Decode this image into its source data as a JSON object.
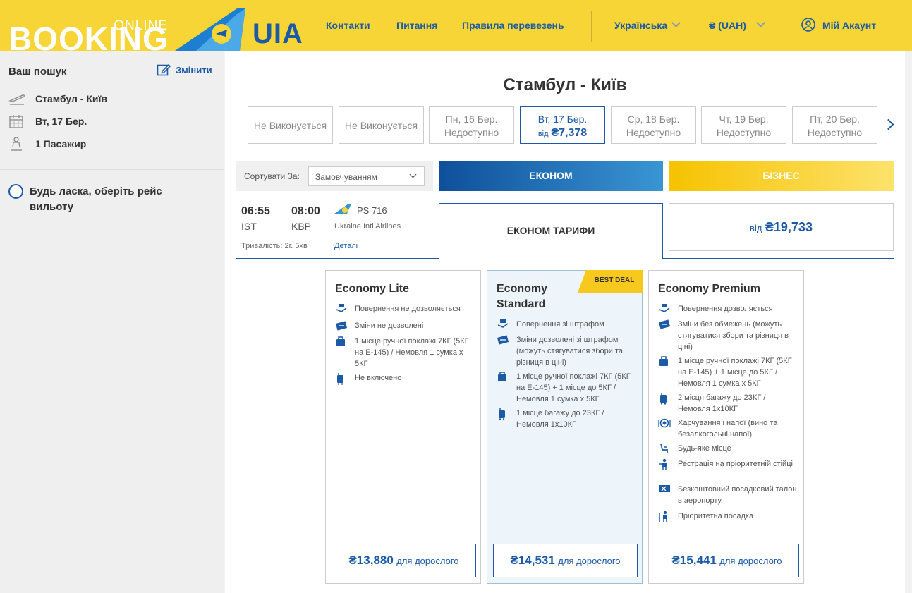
{
  "header": {
    "logo_online": "ONLINE",
    "logo_booking": "BOOKING",
    "logo_uia": "UIA",
    "nav": [
      "Контакти",
      "Питання",
      "Правила перевезень"
    ],
    "language": "Українська",
    "currency": "₴ (UAH)",
    "account": "Мій Акаунт"
  },
  "sidebar": {
    "title": "Ваш пошук",
    "change": "Змінити",
    "route": "Стамбул - Київ",
    "date": "Вт, 17 Бер.",
    "passengers": "1 Пасажир",
    "choose_prompt": "Будь ласка, оберіть рейс вильоту"
  },
  "main": {
    "route_title": "Стамбул - Київ",
    "dates": [
      {
        "l1": "Не Виконується",
        "l2": ""
      },
      {
        "l1": "Не Виконується",
        "l2": ""
      },
      {
        "l1": "Пн, 16 Бер.",
        "l2": "Недоступно"
      },
      {
        "l1": "Вт, 17 Бер.",
        "vid": "від",
        "price": "₴7,378"
      },
      {
        "l1": "Ср, 18 Бер.",
        "l2": "Недоступно"
      },
      {
        "l1": "Чт, 19 Бер.",
        "l2": "Недоступно"
      },
      {
        "l1": "Пт, 20 Бер.",
        "l2": "Недоступно"
      }
    ],
    "sort_label": "Сортувати За:",
    "sort_value": "Замовчуванням",
    "tab_economy": "ЕКОНОМ",
    "tab_business": "БІЗНЕС",
    "flight": {
      "dep_time": "06:55",
      "dep_airport": "IST",
      "arr_time": "08:00",
      "arr_airport": "KBP",
      "number": "PS 716",
      "airline": "Ukraine Intl Airlines",
      "duration": "Тривалість: 2г. 5хв",
      "details": "Деталі"
    },
    "economy_fares_label": "ЕКОНОМ ТАРИФИ",
    "business_from": "від",
    "business_price": "₴19,733"
  },
  "fares": {
    "lite": {
      "name": "Economy Lite",
      "features": [
        "Повернення не дозволяється",
        "Зміни не дозволені",
        "1 місце ручної поклажі 7КГ (5КГ на E-145) / Немовля 1 сумка х 5КГ",
        "Не включено"
      ],
      "price": "₴13,880",
      "per": "для дорослого"
    },
    "standard": {
      "name": "Economy Standard",
      "badge": "BEST DEAL",
      "features": [
        "Повернення зі штрафом",
        "Зміни дозволені зі штрафом (можуть стягуватися збори та різниця в ціні)",
        "1 місце ручної поклажі 7КГ (5КГ на E-145) + 1 місце до 5КГ / Немовля 1 сумка х 5КГ",
        "1 місце багажу до 23КГ / Немовля 1х10КГ"
      ],
      "price": "₴14,531",
      "per": "для дорослого"
    },
    "premium": {
      "name": "Economy Premium",
      "features": [
        "Повернення дозволяється",
        "Зміни без обмежень (можуть стягуватися збори та різниця в ціні)",
        "1 місце ручної поклажі 7КГ (5КГ на E-145) + 1 місце до 5КГ / Немовля 1 сумка х 5КГ",
        "2 місця багажу до 23КГ / Немовля 1х10КГ",
        "Харчування і напої (вино та безалкогольні напої)",
        "Будь-яке місце",
        "Рестрація на пріоритетній стійці",
        "Безкоштовний посадковий талон в аеропорту",
        "Пріоритетна посадка"
      ],
      "price": "₴15,441",
      "per": "для дорослого"
    }
  },
  "colors": {
    "brand_yellow": "#f7d536",
    "brand_blue": "#1c5aa6"
  }
}
